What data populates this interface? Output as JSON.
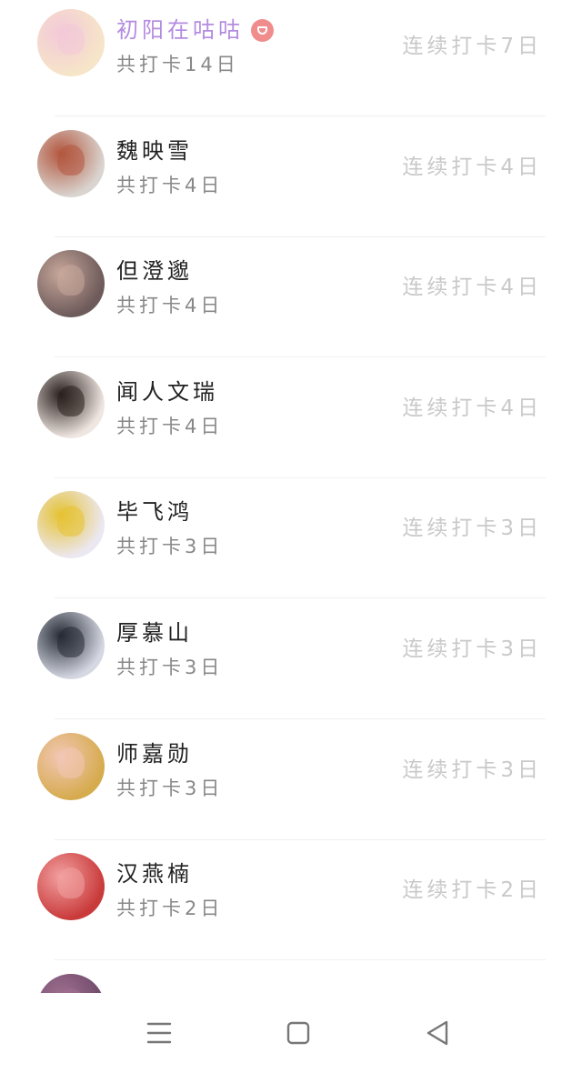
{
  "list": {
    "items": [
      {
        "name": "初阳在咕咕",
        "total": "共打卡14日",
        "streak": "连续打卡7日",
        "vip": true,
        "avatar_icon": "anime-girl-avatar-icon",
        "avatar_colors": [
          "#f6e5c8",
          "#f3c9d8"
        ]
      },
      {
        "name": "魏映雪",
        "total": "共打卡4日",
        "streak": "连续打卡4日",
        "vip": false,
        "avatar_icon": "pinup-figure-avatar-icon",
        "avatar_colors": [
          "#d9d4cf",
          "#b3573f"
        ]
      },
      {
        "name": "但澄邈",
        "total": "共打卡4日",
        "streak": "连续打卡4日",
        "vip": false,
        "avatar_icon": "blurred-photo-avatar-icon",
        "avatar_colors": [
          "#6d5a5a",
          "#c7a79a"
        ]
      },
      {
        "name": "闻人文瑞",
        "total": "共打卡4日",
        "streak": "连续打卡4日",
        "vip": false,
        "avatar_icon": "girl-portrait-avatar-icon",
        "avatar_colors": [
          "#efe6e2",
          "#2a211e"
        ]
      },
      {
        "name": "毕飞鸿",
        "total": "共打卡3日",
        "streak": "连续打卡3日",
        "vip": false,
        "avatar_icon": "fila-poster-avatar-icon",
        "avatar_colors": [
          "#ece8f2",
          "#e5c233"
        ]
      },
      {
        "name": "厚慕山",
        "total": "共打卡3日",
        "streak": "连续打卡3日",
        "vip": false,
        "avatar_icon": "masked-man-avatar-icon",
        "avatar_colors": [
          "#d5d8e2",
          "#262b36"
        ]
      },
      {
        "name": "师嘉勋",
        "total": "共打卡3日",
        "streak": "连续打卡3日",
        "vip": false,
        "avatar_icon": "cartoon-baby-avatar-icon",
        "avatar_colors": [
          "#d6ab4e",
          "#f2c7b5"
        ]
      },
      {
        "name": "汉燕楠",
        "total": "共打卡2日",
        "streak": "连续打卡2日",
        "vip": false,
        "avatar_icon": "red-track-avatar-icon",
        "avatar_colors": [
          "#c93a3a",
          "#f2a0a0"
        ]
      },
      {
        "name": "",
        "total": "",
        "streak": "",
        "vip": false,
        "avatar_icon": "partial-avatar-icon",
        "avatar_colors": [
          "#6f4a6a",
          "#a07090"
        ]
      }
    ]
  },
  "navbar": {
    "buttons": [
      {
        "icon": "menu-icon"
      },
      {
        "icon": "home-square-icon"
      },
      {
        "icon": "back-triangle-icon"
      }
    ]
  },
  "colors": {
    "vip_name": "#b48be0",
    "name": "#222222",
    "total": "#888888",
    "streak": "#c9c9c9",
    "vip_badge": "#f08c8c",
    "divider": "#f0f0f0"
  }
}
